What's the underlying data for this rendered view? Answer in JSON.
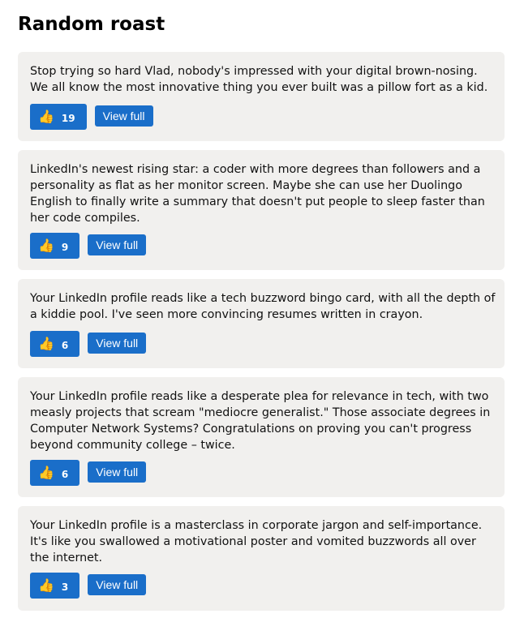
{
  "page": {
    "title": "Random roast"
  },
  "roasts": [
    {
      "text": "Stop trying so hard Vlad, nobody's impressed with your digital brown-nosing. We all know the most innovative thing you ever built was a pillow fort as a kid.",
      "likes": "19",
      "view_label": "View full"
    },
    {
      "text": "LinkedIn's newest rising star: a coder with more degrees than followers and a personality as flat as her monitor screen. Maybe she can use her Duolingo English to finally write a summary that doesn't put people to sleep faster than her code compiles.",
      "likes": "9",
      "view_label": "View full"
    },
    {
      "text": "Your LinkedIn profile reads like a tech buzzword bingo card, with all the depth of a kiddie pool. I've seen more convincing resumes written in crayon.",
      "likes": "6",
      "view_label": "View full"
    },
    {
      "text": "Your LinkedIn profile reads like a desperate plea for relevance in tech, with two measly projects that scream \"mediocre generalist.\" Those associate degrees in Computer Network Systems? Congratulations on proving you can't progress beyond community college – twice.",
      "likes": "6",
      "view_label": "View full"
    },
    {
      "text": "Your LinkedIn profile is a masterclass in corporate jargon and self-importance. It's like you swallowed a motivational poster and vomited buzzwords all over the internet.",
      "likes": "3",
      "view_label": "View full"
    }
  ],
  "icons": {
    "like": "thumbs-up-icon"
  },
  "colors": {
    "button": "#1a6ec9",
    "card_background": "#f1f0ee"
  }
}
